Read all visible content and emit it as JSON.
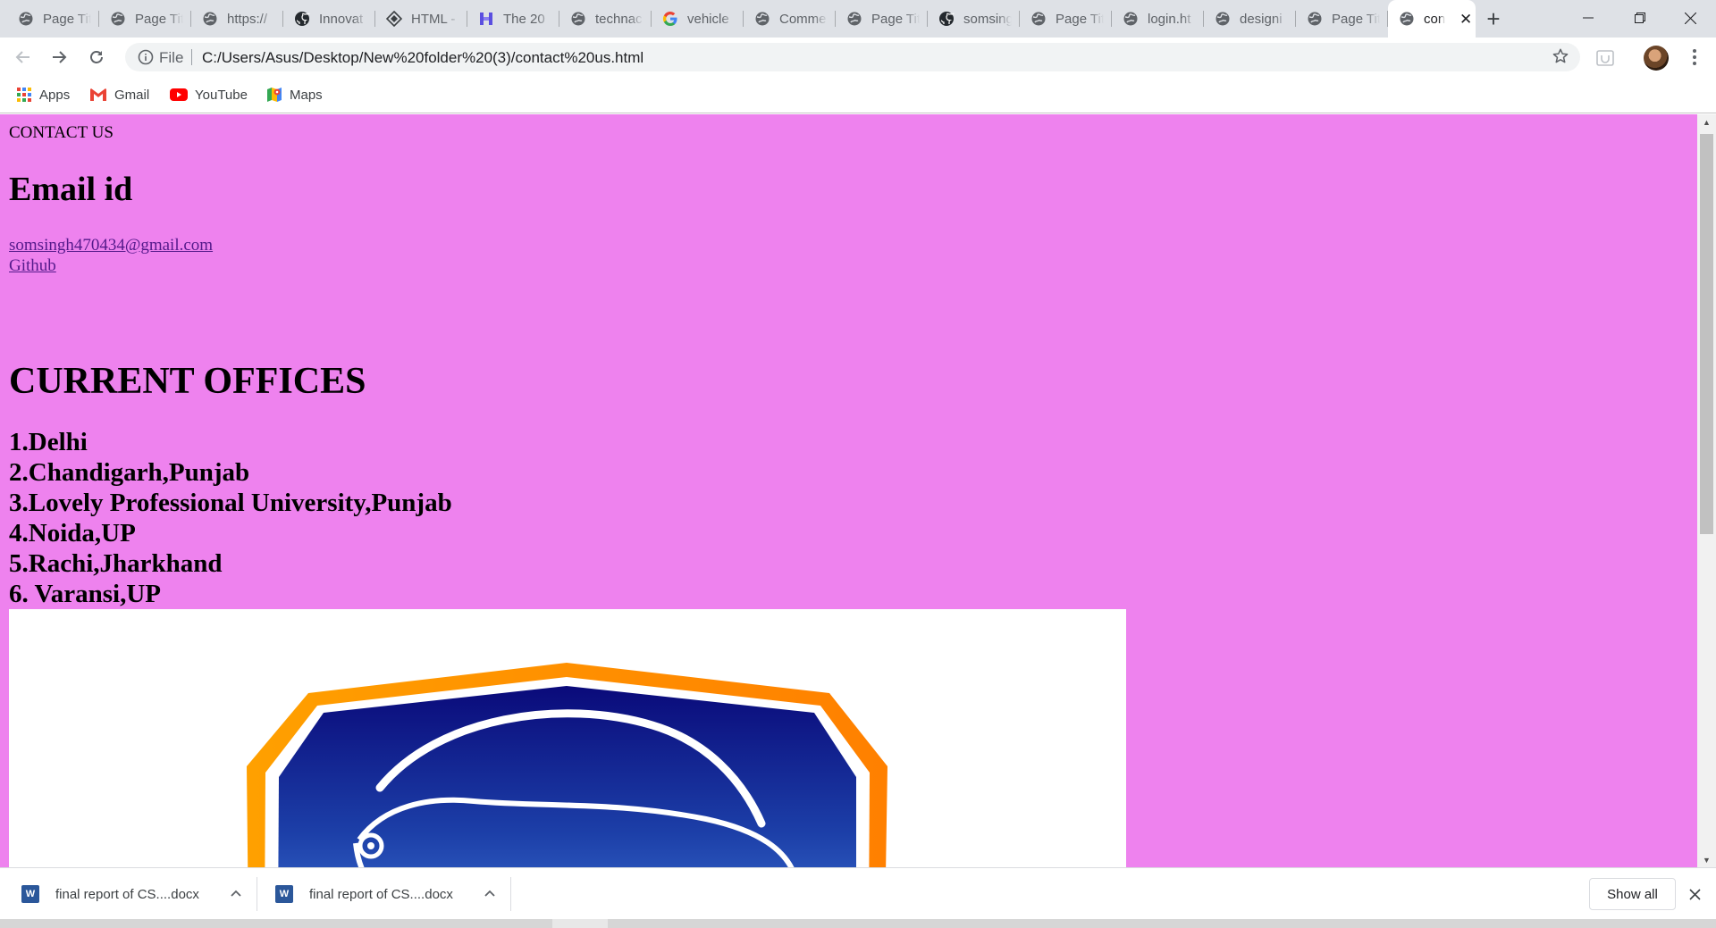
{
  "browser": {
    "tabs": [
      {
        "title": "Page Title",
        "favicon": "globe-icon"
      },
      {
        "title": "Page Title",
        "favicon": "globe-icon"
      },
      {
        "title": "https://",
        "favicon": "globe-icon"
      },
      {
        "title": "Innovat",
        "favicon": "github-icon"
      },
      {
        "title": "HTML -",
        "favicon": "diamond-icon"
      },
      {
        "title": "The 20",
        "favicon": "h-logo-icon"
      },
      {
        "title": "technac",
        "favicon": "globe-icon"
      },
      {
        "title": "vehicle",
        "favicon": "google-icon"
      },
      {
        "title": "Comme",
        "favicon": "globe-icon"
      },
      {
        "title": "Page Tit",
        "favicon": "globe-icon"
      },
      {
        "title": "somsing",
        "favicon": "github-icon"
      },
      {
        "title": "Page Tit",
        "favicon": "globe-icon"
      },
      {
        "title": "login.ht",
        "favicon": "globe-icon"
      },
      {
        "title": "designi",
        "favicon": "globe-icon"
      },
      {
        "title": "Page Tit",
        "favicon": "globe-icon"
      },
      {
        "title": "con",
        "favicon": "globe-icon",
        "active": true
      }
    ],
    "address": {
      "scheme_label": "File",
      "url": "C:/Users/Asus/Desktop/New%20folder%20(3)/contact%20us.html"
    },
    "bookmarks": [
      {
        "label": "Apps",
        "icon": "apps-grid-icon"
      },
      {
        "label": "Gmail",
        "icon": "gmail-icon"
      },
      {
        "label": "YouTube",
        "icon": "youtube-icon"
      },
      {
        "label": "Maps",
        "icon": "maps-icon"
      }
    ]
  },
  "page": {
    "background": "#ee82ee",
    "contact_title": "CONTACT US",
    "email_heading": "Email id",
    "email_link": "somsingh470434@gmail.com",
    "github_link": "Github",
    "offices_heading": "CURRENT OFFICES",
    "offices": [
      "1.Delhi",
      "2.Chandigarh,Punjab",
      "3.Lovely Professional University,Punjab",
      "4.Noida,UP",
      "5.Rachi,Jharkhand",
      "6. Varansi,UP"
    ]
  },
  "downloads": {
    "items": [
      {
        "name": "final report of CS....docx"
      },
      {
        "name": "final report of CS....docx"
      }
    ],
    "show_all_label": "Show all"
  }
}
